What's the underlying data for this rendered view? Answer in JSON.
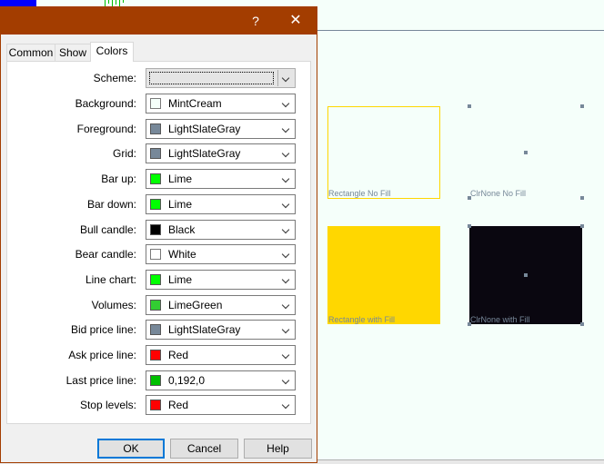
{
  "window": {
    "help_glyph": "?",
    "close_glyph": "✕"
  },
  "tabs": [
    {
      "label": "Common",
      "active": false
    },
    {
      "label": "Show",
      "active": false
    },
    {
      "label": "Colors",
      "active": true
    }
  ],
  "scheme": {
    "label": "Scheme:",
    "value": ""
  },
  "color_rows": [
    {
      "label": "Background:",
      "value": "MintCream",
      "color": "#F5FFFA"
    },
    {
      "label": "Foreground:",
      "value": "LightSlateGray",
      "color": "#778899"
    },
    {
      "label": "Grid:",
      "value": "LightSlateGray",
      "color": "#778899"
    },
    {
      "label": "Bar up:",
      "value": "Lime",
      "color": "#00FF00"
    },
    {
      "label": "Bar down:",
      "value": "Lime",
      "color": "#00FF00"
    },
    {
      "label": "Bull candle:",
      "value": "Black",
      "color": "#000000"
    },
    {
      "label": "Bear candle:",
      "value": "White",
      "color": "#FFFFFF"
    },
    {
      "label": "Line chart:",
      "value": "Lime",
      "color": "#00FF00"
    },
    {
      "label": "Volumes:",
      "value": "LimeGreen",
      "color": "#32CD32"
    },
    {
      "label": "Bid price line:",
      "value": "LightSlateGray",
      "color": "#778899"
    },
    {
      "label": "Ask price line:",
      "value": "Red",
      "color": "#FF0000"
    },
    {
      "label": "Last price line:",
      "value": "0,192,0",
      "color": "#00C000"
    },
    {
      "label": "Stop levels:",
      "value": "Red",
      "color": "#FF0000"
    }
  ],
  "buttons": {
    "ok": "OK",
    "cancel": "Cancel",
    "help": "Help"
  },
  "chart_objects": {
    "rect_no_fill": "Rectangle No Fill",
    "clrnone_no_fill": "ClrNone No Fill",
    "rect_with_fill": "Rectangle with Fill",
    "clrnone_with_fill": "ClrNone with Fill"
  },
  "colors": {
    "titlebar": "#A33D00",
    "chart_background": "#F5FFFA",
    "rectangle_fill": "#FFD700",
    "clrnone_fill": "#0A0710",
    "selection_handle": "#778899"
  }
}
